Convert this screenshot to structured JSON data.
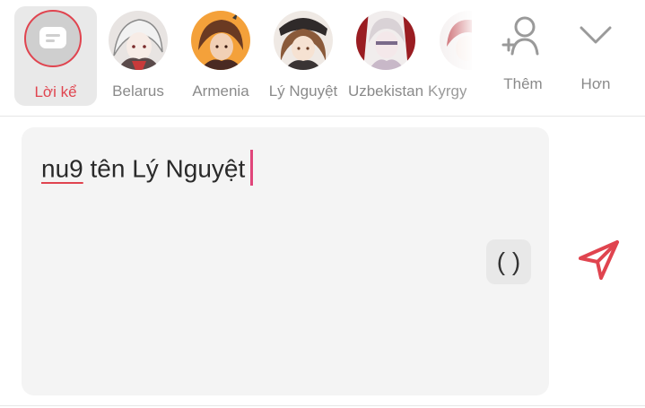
{
  "characters": [
    {
      "label": "Lời kể",
      "selected": true,
      "icon": "narrator-card-icon"
    },
    {
      "label": "Belarus"
    },
    {
      "label": "Armenia"
    },
    {
      "label": "Lý Nguyệt"
    },
    {
      "label": "Uzbekistan"
    },
    {
      "label": "Kyrgy"
    }
  ],
  "actions": {
    "add_label": "Thêm",
    "more_label": "Hơn"
  },
  "composer": {
    "misspelled_word": "nu9",
    "rest_text": " tên Lý Nguyệt",
    "paren_button_label": "( )"
  },
  "colors": {
    "accent": "#e0444f",
    "caret": "#e0457a",
    "composer_bg": "#f4f4f4",
    "selected_bg": "#e9e9e9"
  }
}
